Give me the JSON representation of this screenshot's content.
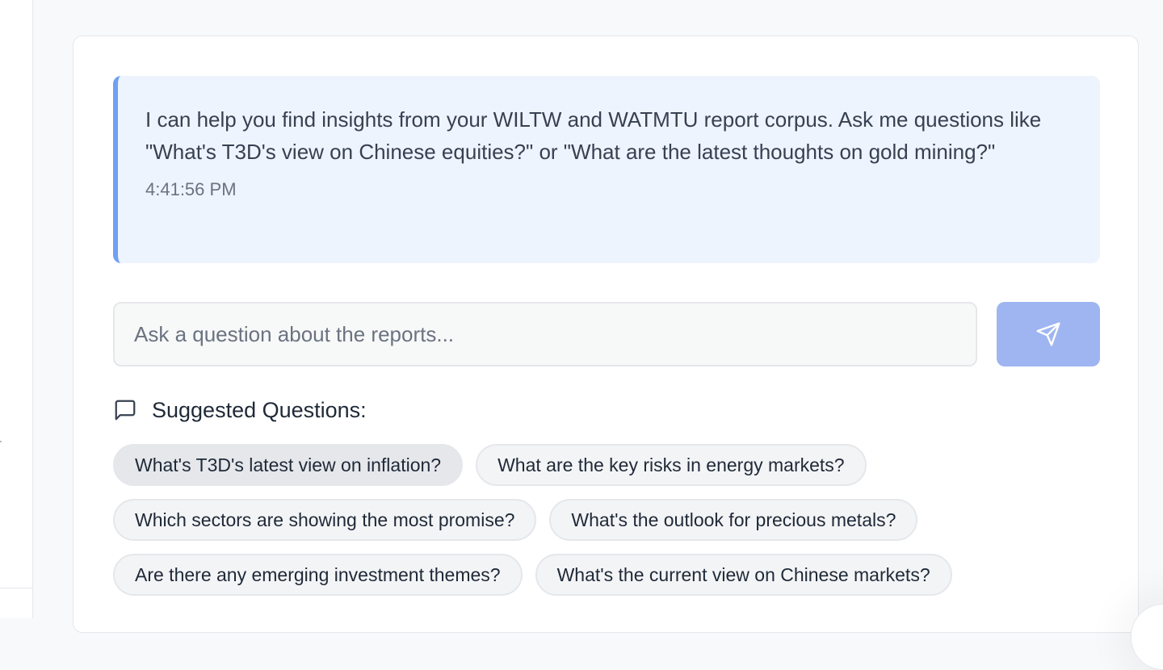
{
  "chat": {
    "assistant_message": {
      "text": "I can help you find insights from your WILTW and WATMTU report corpus. Ask me questions like \"What's T3D's view on Chinese equities?\" or \"What are the latest thoughts on gold mining?\"",
      "timestamp": "4:41:56 PM"
    },
    "input": {
      "value": "",
      "placeholder": "Ask a question about the reports..."
    },
    "send_button": {
      "icon": "send-icon",
      "color": "#9eb5f1"
    }
  },
  "suggestions": {
    "title": "Suggested Questions:",
    "icon": "message-square-icon",
    "items": [
      "What's T3D's latest view on inflation?",
      "What are the key risks in energy markets?",
      "Which sectors are showing the most promise?",
      "What's the outlook for precious metals?",
      "Are there any emerging investment themes?",
      "What's the current view on Chinese markets?"
    ]
  },
  "colors": {
    "accent": "#6ea0f3",
    "message_bg": "#eef4fe"
  }
}
